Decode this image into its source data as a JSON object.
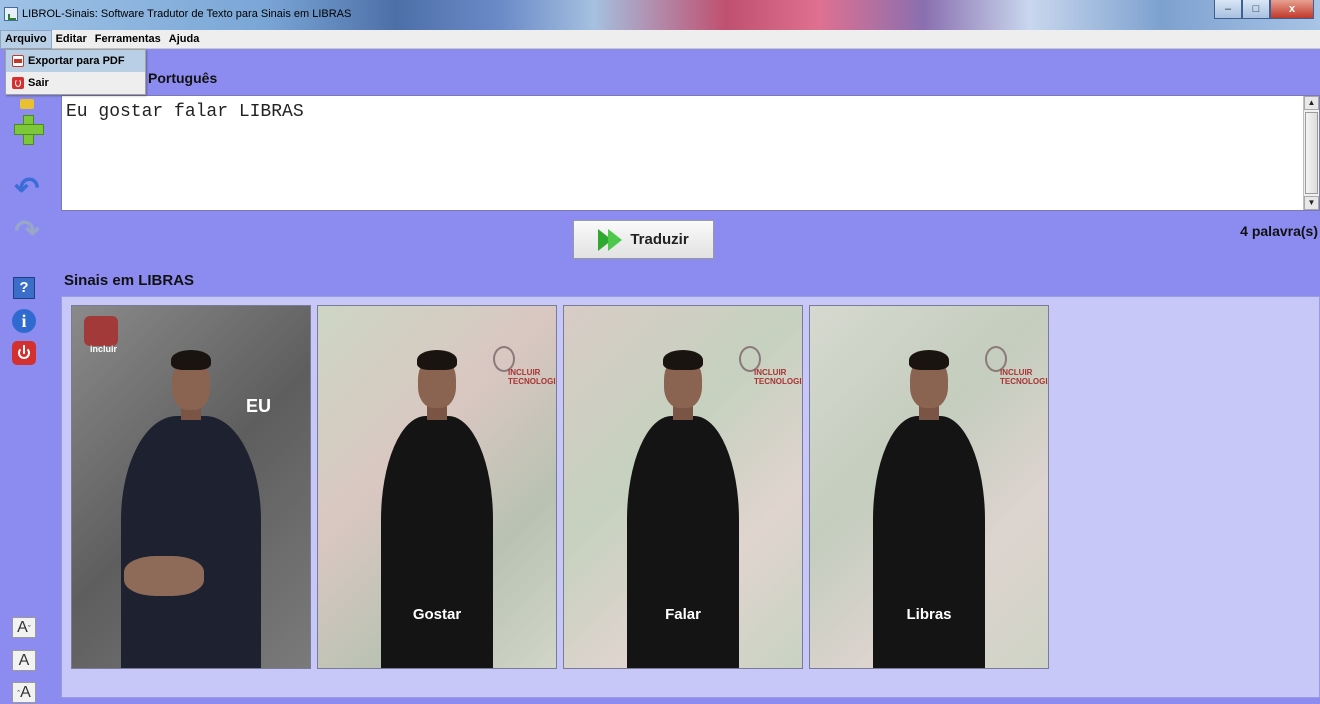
{
  "window": {
    "title": "LIBROL-Sinais: Software Tradutor de Texto para Sinais em LIBRAS",
    "minimize": "–",
    "maximize": "□",
    "close": "x"
  },
  "menubar": {
    "items": [
      {
        "label": "Arquivo"
      },
      {
        "label": "Editar"
      },
      {
        "label": "Ferramentas"
      },
      {
        "label": "Ajuda"
      }
    ]
  },
  "dropdown": {
    "items": [
      {
        "label": "Exportar para PDF",
        "icon": "pdf-icon"
      },
      {
        "label": "Sair",
        "icon": "exit-icon"
      }
    ]
  },
  "toolbar": {
    "help_label": "?",
    "info_label": "i",
    "font_decrease": "A",
    "font_normal": "A",
    "font_increase": "A"
  },
  "input": {
    "section_label": "Português",
    "text": "Eu gostar falar LIBRAS"
  },
  "translate": {
    "button_label": "Traduzir",
    "word_count": "4 palavra(s)"
  },
  "signs": {
    "section_label": "Sinais em LIBRAS",
    "cards": [
      {
        "word": "EU",
        "logo": "incluir"
      },
      {
        "word": "Gostar",
        "logo": "INCLUIR TECNOLOGIA"
      },
      {
        "word": "Falar",
        "logo": "INCLUIR TECNOLOGIA"
      },
      {
        "word": "Libras",
        "logo": "INCLUIR TECNOLOGIA"
      }
    ]
  },
  "colors": {
    "background": "#8c8cf0",
    "signs_panel": "#c8c8f8",
    "accent_green": "#2fa82f",
    "power_red": "#d43030"
  }
}
